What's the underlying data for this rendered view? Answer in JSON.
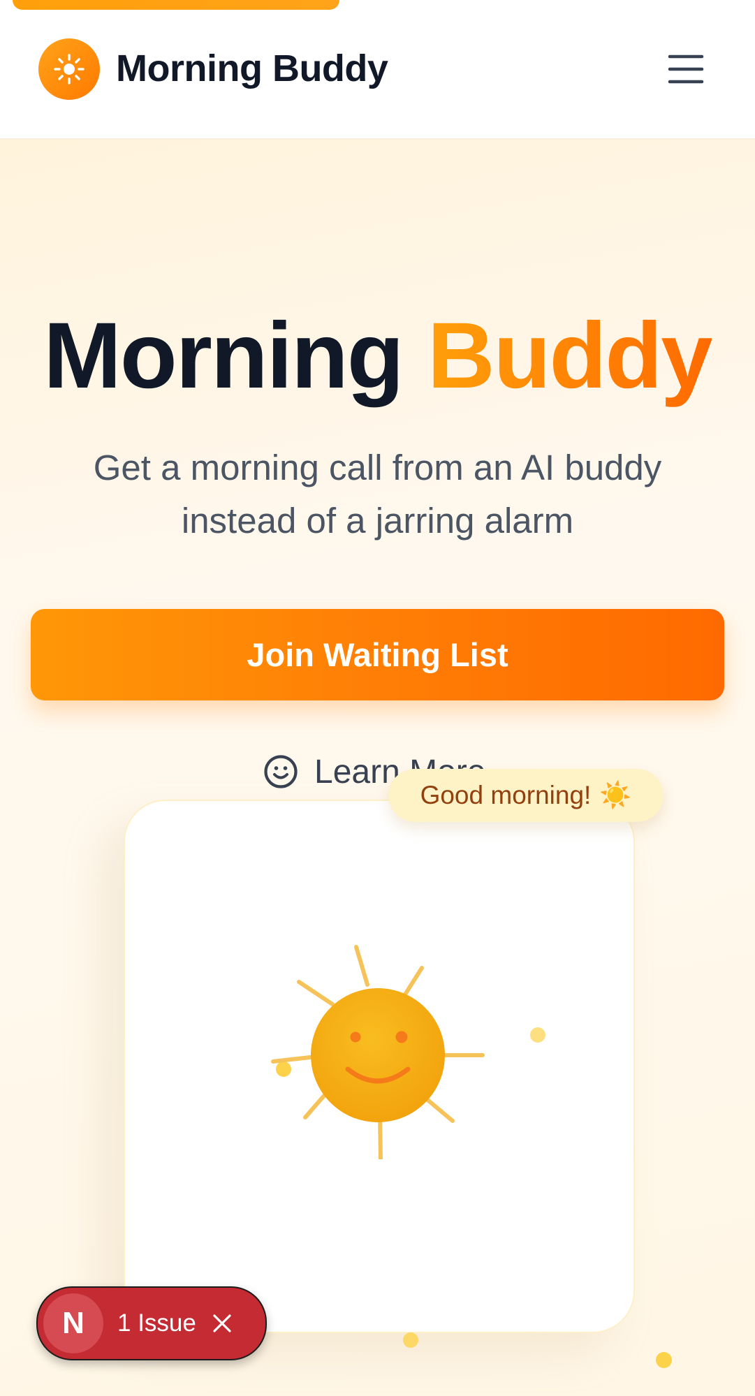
{
  "header": {
    "brand_name": "Morning Buddy",
    "logo_icon": "sun-icon",
    "menu_icon": "hamburger-menu-icon"
  },
  "hero": {
    "title_main": "Morning",
    "title_accent": "Buddy",
    "subtitle": "Get a morning call from an AI buddy instead of a jarring alarm",
    "cta_label": "Join Waiting List",
    "learn_more_label": "Learn More",
    "learn_more_icon": "smiley-face-icon"
  },
  "illustration": {
    "bubble_text": "Good morning!",
    "bubble_emoji": "☀️",
    "sun_character_icon": "smiling-sun-icon"
  },
  "dev_overlay": {
    "badge_letter": "N",
    "issue_label": "1 Issue",
    "close_icon": "close-icon"
  },
  "colors": {
    "accent_orange": "#ff8a00",
    "accent_gradient_start": "#ff9f0a",
    "accent_gradient_end": "#ff6a00",
    "heading_dark": "#111827",
    "body_gray": "#4b5563",
    "issue_red": "#c42b33",
    "bubble_bg": "#fef3c7",
    "bubble_text": "#92400e"
  }
}
